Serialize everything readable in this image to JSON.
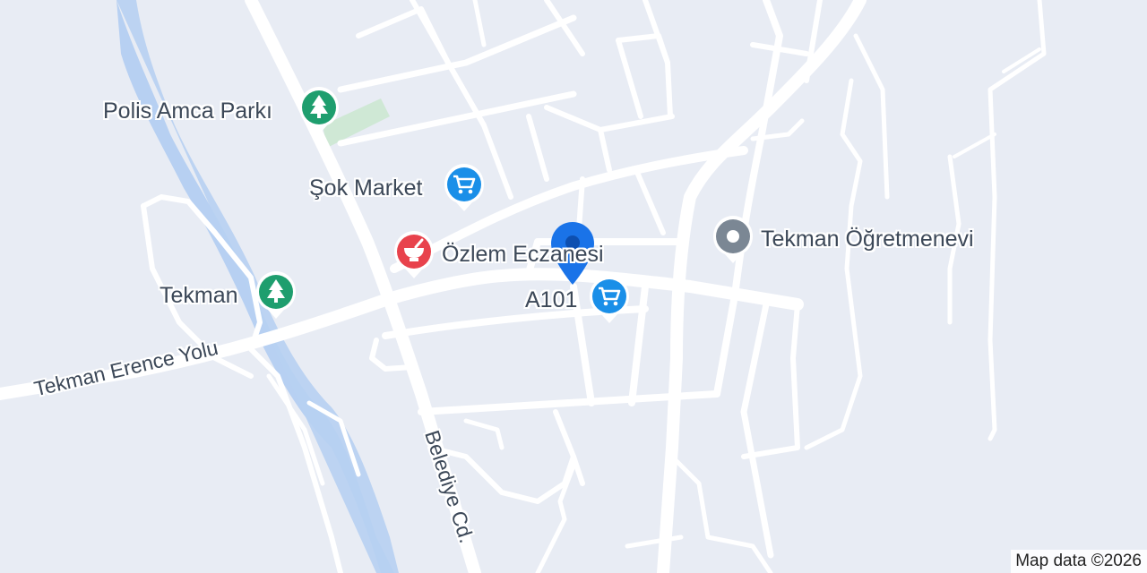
{
  "map": {
    "places": [
      {
        "id": "polis-amca-parki",
        "name": "Polis Amca Parkı",
        "category": "park",
        "icon": "tree-icon",
        "color": "#1e9e6e"
      },
      {
        "id": "sok-market",
        "name": "Şok Market",
        "category": "shopping",
        "icon": "shopping-cart-icon",
        "color": "#1a8fe8"
      },
      {
        "id": "ozlem-eczanesi",
        "name": "Özlem Eczanesi",
        "category": "pharmacy",
        "icon": "mortar-pestle-icon",
        "color": "#e8424c"
      },
      {
        "id": "tekman-park",
        "name": "Tekman",
        "category": "park",
        "icon": "tree-icon",
        "color": "#1e9e6e"
      },
      {
        "id": "a101",
        "name": "A101",
        "category": "shopping",
        "icon": "shopping-cart-icon",
        "color": "#1a8fe8"
      },
      {
        "id": "tekman-ogretmenevi",
        "name": "Tekman Öğretmenevi",
        "category": "generic",
        "icon": "circle-dot-icon",
        "color": "#7b8794"
      }
    ],
    "roads": [
      {
        "name": "Tekman Erence Yolu"
      },
      {
        "name": "Belediye Cd."
      }
    ],
    "current_location": {
      "icon": "location-pin-icon",
      "color": "#1a73e8"
    },
    "attribution": "Map data ©2026",
    "colors": {
      "land": "#e8ecf4",
      "road": "#ffffff",
      "water": "#b7d0f2",
      "park": "#cfe8d5"
    }
  }
}
